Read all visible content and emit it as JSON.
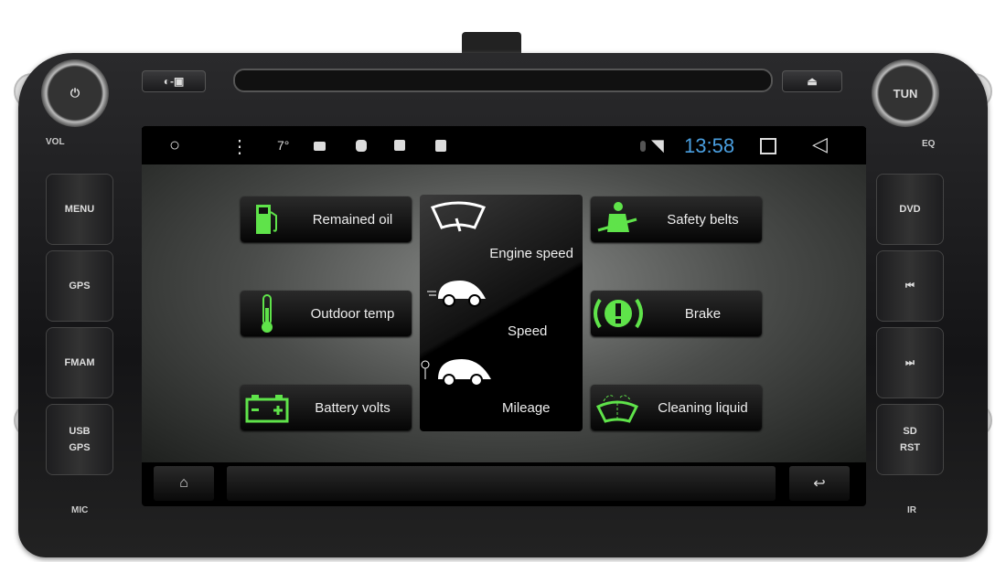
{
  "device": {
    "left_labels": {
      "vol": "VOL",
      "menu": "MENU",
      "gps": "GPS",
      "fmam": "FMAM",
      "usb_gps_1": "USB",
      "usb_gps_2": "GPS",
      "mic": "MIC"
    },
    "right_labels": {
      "tun": "TUN",
      "eq": "EQ",
      "dvd": "DVD",
      "prev": "⏮",
      "next": "⏭",
      "sd_rst_1": "SD",
      "sd_rst_2": "RST",
      "ir": "IR"
    },
    "top": {
      "eject": "⏏",
      "aux": "◐-▣"
    }
  },
  "status_bar": {
    "temperature": "7°",
    "time": "13:58",
    "time_color": "#4a9fe0"
  },
  "tiles": {
    "left": [
      {
        "label": "Remained oil",
        "icon": "fuel-pump-icon"
      },
      {
        "label": "Outdoor temp",
        "icon": "thermometer-icon"
      },
      {
        "label": "Battery volts",
        "icon": "battery-icon"
      }
    ],
    "center": [
      {
        "label": "Engine speed",
        "icon": "gauge-icon"
      },
      {
        "label": "Speed",
        "icon": "car-speed-icon"
      },
      {
        "label": "Mileage",
        "icon": "car-mileage-icon"
      }
    ],
    "right": [
      {
        "label": "Safety belts",
        "icon": "seatbelt-icon"
      },
      {
        "label": "Brake",
        "icon": "brake-warning-icon"
      },
      {
        "label": "Cleaning liquid",
        "icon": "washer-fluid-icon"
      }
    ]
  },
  "colors": {
    "icon_green": "#5fe34a"
  }
}
